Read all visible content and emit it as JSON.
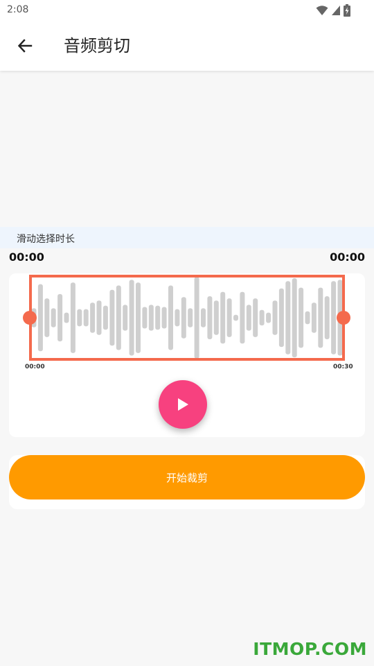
{
  "status_bar": {
    "time": "2:08",
    "icons": [
      "wifi-icon",
      "cell-signal-icon",
      "battery-charging-icon"
    ]
  },
  "app_bar": {
    "back_icon": "arrow-left-icon",
    "title": "音频剪切"
  },
  "hint": "滑动选择时长",
  "selection": {
    "start_time": "00:00",
    "end_time": "00:00"
  },
  "waveform": {
    "axis_start": "00:00",
    "axis_end": "00:30",
    "bar_levels": [
      0.22,
      0.78,
      0.45,
      0.22,
      0.55,
      0.12,
      0.82,
      0.2,
      0.2,
      0.35,
      0.4,
      0.28,
      0.65,
      0.75,
      0.3,
      0.88,
      0.82,
      0.25,
      0.3,
      0.28,
      0.25,
      0.75,
      0.2,
      0.48,
      0.22,
      0.95,
      0.22,
      0.5,
      0.4,
      0.6,
      0.45,
      0.07,
      0.6,
      0.3,
      0.45,
      0.18,
      0.12,
      0.4,
      0.68,
      0.85,
      0.92,
      0.7,
      0.15,
      0.35,
      0.7,
      0.5,
      0.85,
      0.88
    ]
  },
  "player": {
    "play_icon": "play-icon"
  },
  "actions": {
    "crop_label": "开始裁剪"
  },
  "watermark": "ITMOP.COM",
  "colors": {
    "accent_orange": "#ff9a00",
    "selection_red": "#f46a4d",
    "play_pink": "#f7417f",
    "bar_gray": "#cfcfcf",
    "hint_bg": "#eef5fd",
    "watermark_green": "#3aa83a"
  }
}
